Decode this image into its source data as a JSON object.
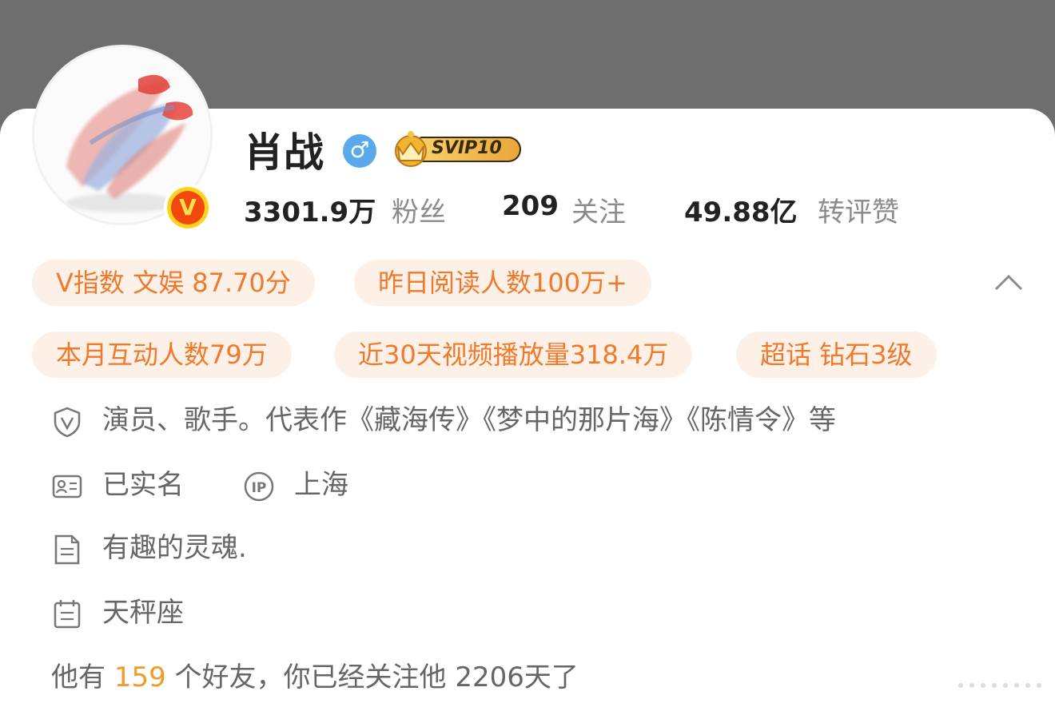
{
  "profile": {
    "name": "肖战",
    "gender_symbol": "♂",
    "svip_label": "SVIP10",
    "verified_mark": "V"
  },
  "stats": [
    {
      "value": "3301.9万",
      "label": "粉丝"
    },
    {
      "value": "209",
      "label": "关注"
    },
    {
      "value": "49.88亿",
      "label": "转评赞"
    }
  ],
  "chips": [
    "V指数 文娱 87.70分",
    "昨日阅读人数100万+",
    "本月互动人数79万",
    "近30天视频播放量318.4万",
    "超话 钻石3级"
  ],
  "info": {
    "bio": "演员、歌手。代表作《藏海传》《梦中的那片海》《陈情令》等",
    "real_name_status": "已实名",
    "ip_location": "上海",
    "description": "有趣的灵魂.",
    "constellation": "天秤座"
  },
  "footer": {
    "prefix": "他有",
    "friends_count": "159",
    "suffix": "个好友，你已经关注他",
    "days": "2206",
    "end": "天了"
  },
  "colors": {
    "accent_orange": "#ef7a2d",
    "chip_bg": "#fdf0e6",
    "highlight": "#f19a27",
    "header_gray": "#6e6e6e",
    "gender_blue": "#5aa9ec"
  },
  "icons": [
    "shield-v-icon",
    "id-card-icon",
    "ip-icon",
    "document-icon",
    "calendar-icon",
    "chevron-up-icon",
    "crown-icon"
  ]
}
